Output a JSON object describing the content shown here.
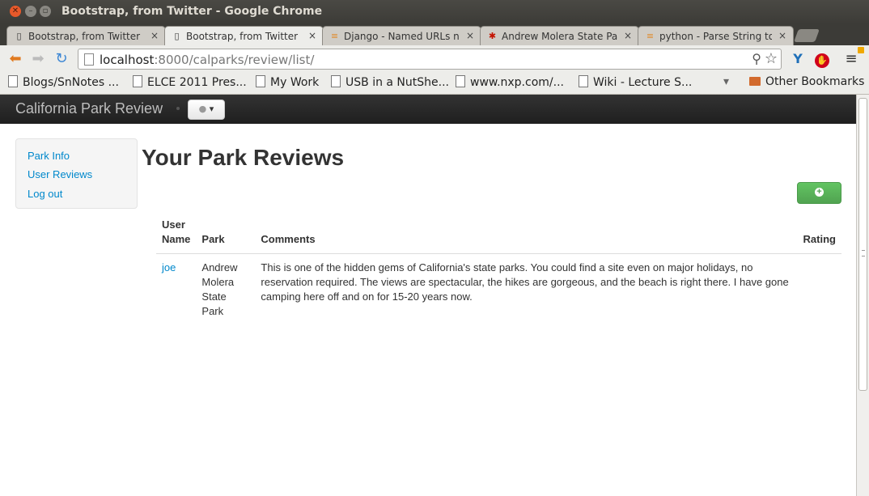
{
  "window": {
    "title": "Bootstrap, from Twitter - Google Chrome",
    "close_glyph": "✕",
    "min_glyph": "–",
    "max_glyph": "▫"
  },
  "tabs": [
    {
      "label": "Bootstrap, from Twitter",
      "icon": "page-icon"
    },
    {
      "label": "Bootstrap, from Twitter",
      "icon": "page-icon"
    },
    {
      "label": "Django - Named URLs not",
      "icon": "stackoverflow-icon"
    },
    {
      "label": "Andrew Molera State Par",
      "icon": "yelp-icon"
    },
    {
      "label": "python - Parse String to F",
      "icon": "stackoverflow-icon"
    }
  ],
  "tab_close_glyph": "×",
  "address": {
    "host": "localhost",
    "rest": ":8000/calparks/review/list/"
  },
  "bookmarks": [
    {
      "label": "Blogs/SnNotes ..."
    },
    {
      "label": "ELCE 2011 Pres..."
    },
    {
      "label": "My Work"
    },
    {
      "label": "USB in a NutShe..."
    },
    {
      "label": "www.nxp.com/..."
    },
    {
      "label": "Wiki - Lecture S..."
    }
  ],
  "bookmarks_overflow": "▾",
  "other_bookmarks": "Other Bookmarks",
  "navbar": {
    "brand": "California Park Review",
    "user_glyph": "▾"
  },
  "sidebar": {
    "items": [
      {
        "label": "Park Info"
      },
      {
        "label": "User Reviews"
      },
      {
        "label": "Log out"
      }
    ]
  },
  "page": {
    "title": "Your Park Reviews",
    "add_glyph": "+"
  },
  "table": {
    "headers": [
      "User Name",
      "Park",
      "Comments",
      "Rating"
    ],
    "rows": [
      {
        "user": "joe",
        "park": "Andrew Molera State Park",
        "comments": "This is one of the hidden gems of California's state parks. You could find a site even on major holidays, no reservation required. The views are spectacular, the hikes are gorgeous, and the beach is right there. I have gone camping here off and on for 15-20 years now.",
        "rating": ""
      }
    ]
  },
  "colors": {
    "link": "#0088cc",
    "success": "#51a351",
    "navbar": "#222222"
  }
}
